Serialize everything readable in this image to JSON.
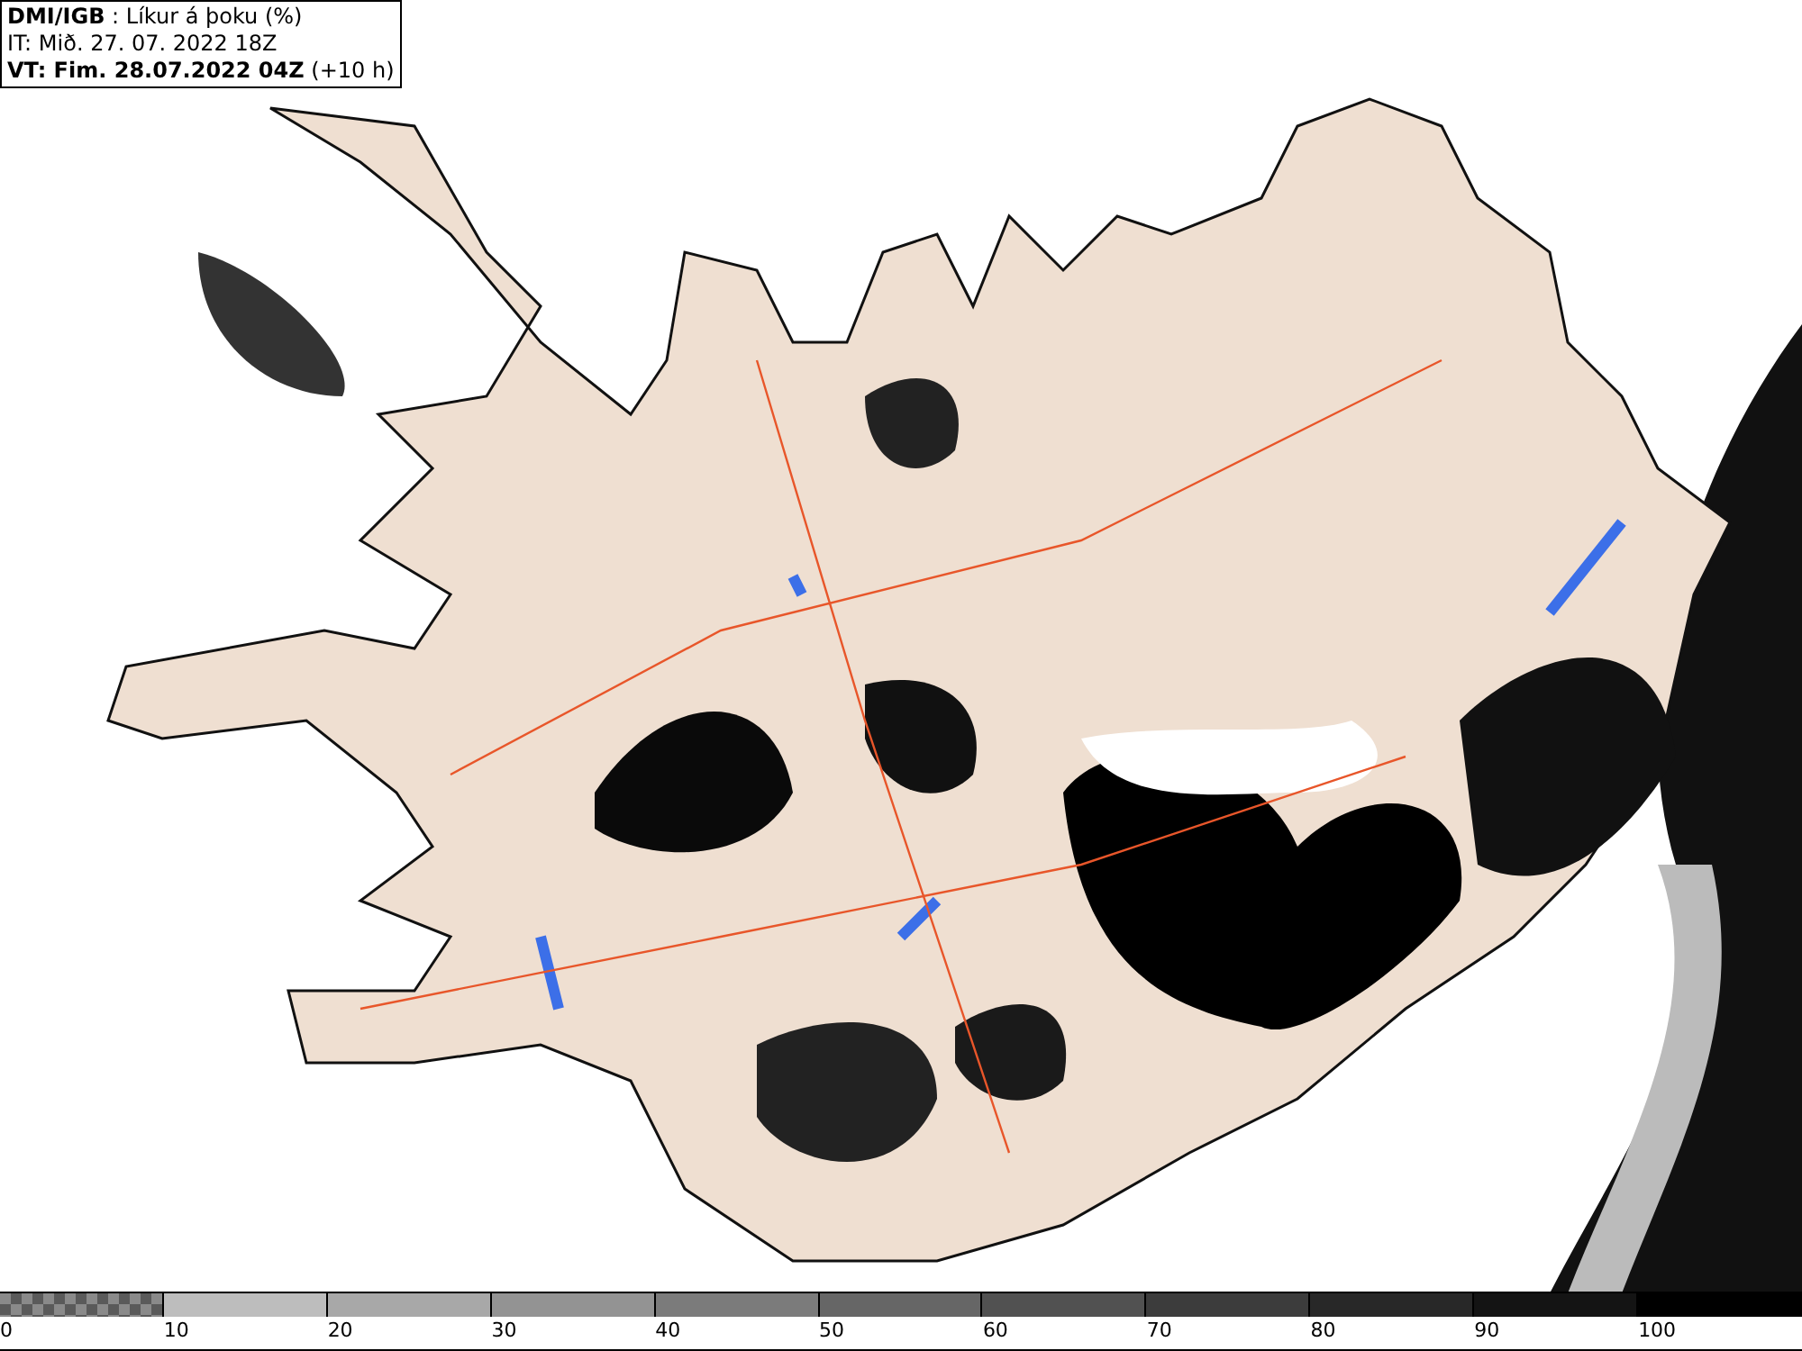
{
  "header": {
    "lines": [
      "**DMI/IGB** : Líkur á þoku (%)",
      "IT: Mið. 27. 07. 2022 18Z",
      "**VT: Fim. 28.07.2022 04Z** (+10 h)"
    ]
  },
  "legend": {
    "items": [
      {
        "label": "0",
        "color": "#5a5a5a",
        "kind": "checker"
      },
      {
        "label": "10",
        "color": "#bdbdbd",
        "kind": "solid"
      },
      {
        "label": "20",
        "color": "#a8a8a8",
        "kind": "solid"
      },
      {
        "label": "30",
        "color": "#939393",
        "kind": "solid"
      },
      {
        "label": "40",
        "color": "#7b7b7b",
        "kind": "solid"
      },
      {
        "label": "50",
        "color": "#666666",
        "kind": "solid"
      },
      {
        "label": "60",
        "color": "#515151",
        "kind": "solid"
      },
      {
        "label": "70",
        "color": "#3c3c3c",
        "kind": "solid"
      },
      {
        "label": "80",
        "color": "#282828",
        "kind": "solid"
      },
      {
        "label": "90",
        "color": "#141414",
        "kind": "solid"
      },
      {
        "label": "100",
        "color": "#000000",
        "kind": "solid"
      }
    ]
  }
}
